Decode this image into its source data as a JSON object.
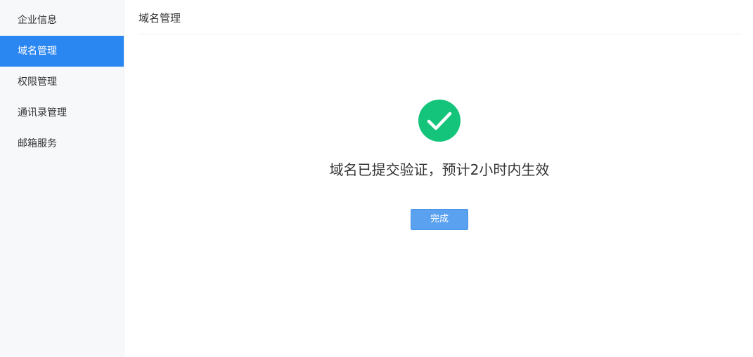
{
  "sidebar": {
    "items": [
      {
        "label": "企业信息",
        "active": false
      },
      {
        "label": "域名管理",
        "active": true
      },
      {
        "label": "权限管理",
        "active": false
      },
      {
        "label": "通讯录管理",
        "active": false
      },
      {
        "label": "邮箱服务",
        "active": false
      }
    ]
  },
  "header": {
    "title": "域名管理"
  },
  "result": {
    "icon": "check-circle-icon",
    "message": "域名已提交验证，预计2小时内生效",
    "button_label": "完成"
  },
  "colors": {
    "sidebar_active_bg": "#2a86f0",
    "success_green": "#13c47a",
    "button_bg": "#5aa2f0"
  }
}
